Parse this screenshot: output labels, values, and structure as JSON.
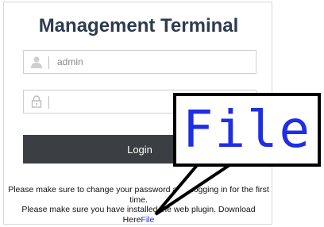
{
  "header": {
    "title": "Management Terminal"
  },
  "login_form": {
    "username_value": "admin",
    "password_value": "",
    "login_label": "Login"
  },
  "notes": {
    "line1": "Please make sure to change your password after logging in for the first time.",
    "line2_prefix": "Please make sure you have installed the web plugin. Download Here",
    "download_link": "File"
  },
  "callout": {
    "text": "File"
  },
  "colors": {
    "title": "#2f3b4f",
    "button_bg": "#3b3f43",
    "link": "#1a2fe0",
    "callout_text": "#1f2ee6"
  },
  "icons": [
    "user-icon",
    "lock-icon"
  ]
}
